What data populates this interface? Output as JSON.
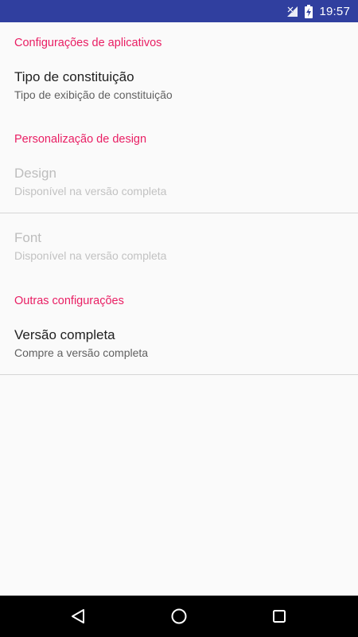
{
  "status_bar": {
    "time": "19:57",
    "icons": [
      "signal-off-icon",
      "battery-charging-icon"
    ]
  },
  "sections": {
    "app_settings": {
      "header": "Configurações de aplicativos",
      "items": [
        {
          "title": "Tipo de constituição",
          "summary": "Tipo de exibição de constituição",
          "enabled": true
        }
      ]
    },
    "design": {
      "header": "Personalização de design",
      "items": [
        {
          "title": "Design",
          "summary": "Disponível na versão completa",
          "enabled": false
        },
        {
          "title": "Font",
          "summary": "Disponível na versão completa",
          "enabled": false
        }
      ]
    },
    "other": {
      "header": "Outras configurações",
      "items": [
        {
          "title": "Versão completa",
          "summary": "Compre a versão completa",
          "enabled": true
        }
      ]
    }
  },
  "nav_bar": {
    "buttons": [
      "back-icon",
      "home-icon",
      "recents-icon"
    ]
  },
  "colors": {
    "status_bar": "#303f9f",
    "accent": "#e91e63",
    "background": "#fafafa",
    "nav_bar": "#000000"
  }
}
